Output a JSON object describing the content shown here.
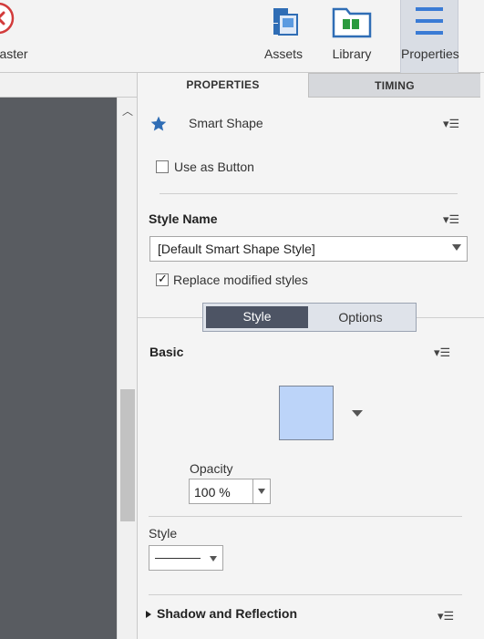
{
  "toolbar": {
    "exit_master_label": "t Master",
    "assets_label": "Assets",
    "library_label": "Library",
    "properties_label": "Properties"
  },
  "panel": {
    "tabs": [
      {
        "label": "PROPERTIES",
        "active": true
      },
      {
        "label": "TIMING",
        "active": false
      }
    ],
    "object_name": "Smart Shape",
    "use_as_button": {
      "label": "Use as Button",
      "checked": false
    },
    "style_name": {
      "title": "Style Name",
      "selected": "[Default Smart Shape Style]",
      "replace_modified": {
        "label": "Replace modified styles",
        "checked": true
      }
    },
    "segmented": {
      "active": "Style",
      "inactive": "Options"
    },
    "basic": {
      "title": "Basic",
      "fill_color": "#bcd4f9",
      "opacity_label": "Opacity",
      "opacity_value": "100 %",
      "style_label": "Style"
    },
    "shadow_section": "Shadow and Reflection"
  },
  "colors": {
    "accent": "#2f6db5",
    "canvas_dark": "#595c61",
    "active_segment": "#4d5464"
  },
  "icons": {
    "exit": "close-circle-icon",
    "assets": "assets-icon",
    "library": "library-folder-icon",
    "properties": "hamburger-icon",
    "star": "star-icon",
    "panel_menu": "panel-menu-icon"
  }
}
